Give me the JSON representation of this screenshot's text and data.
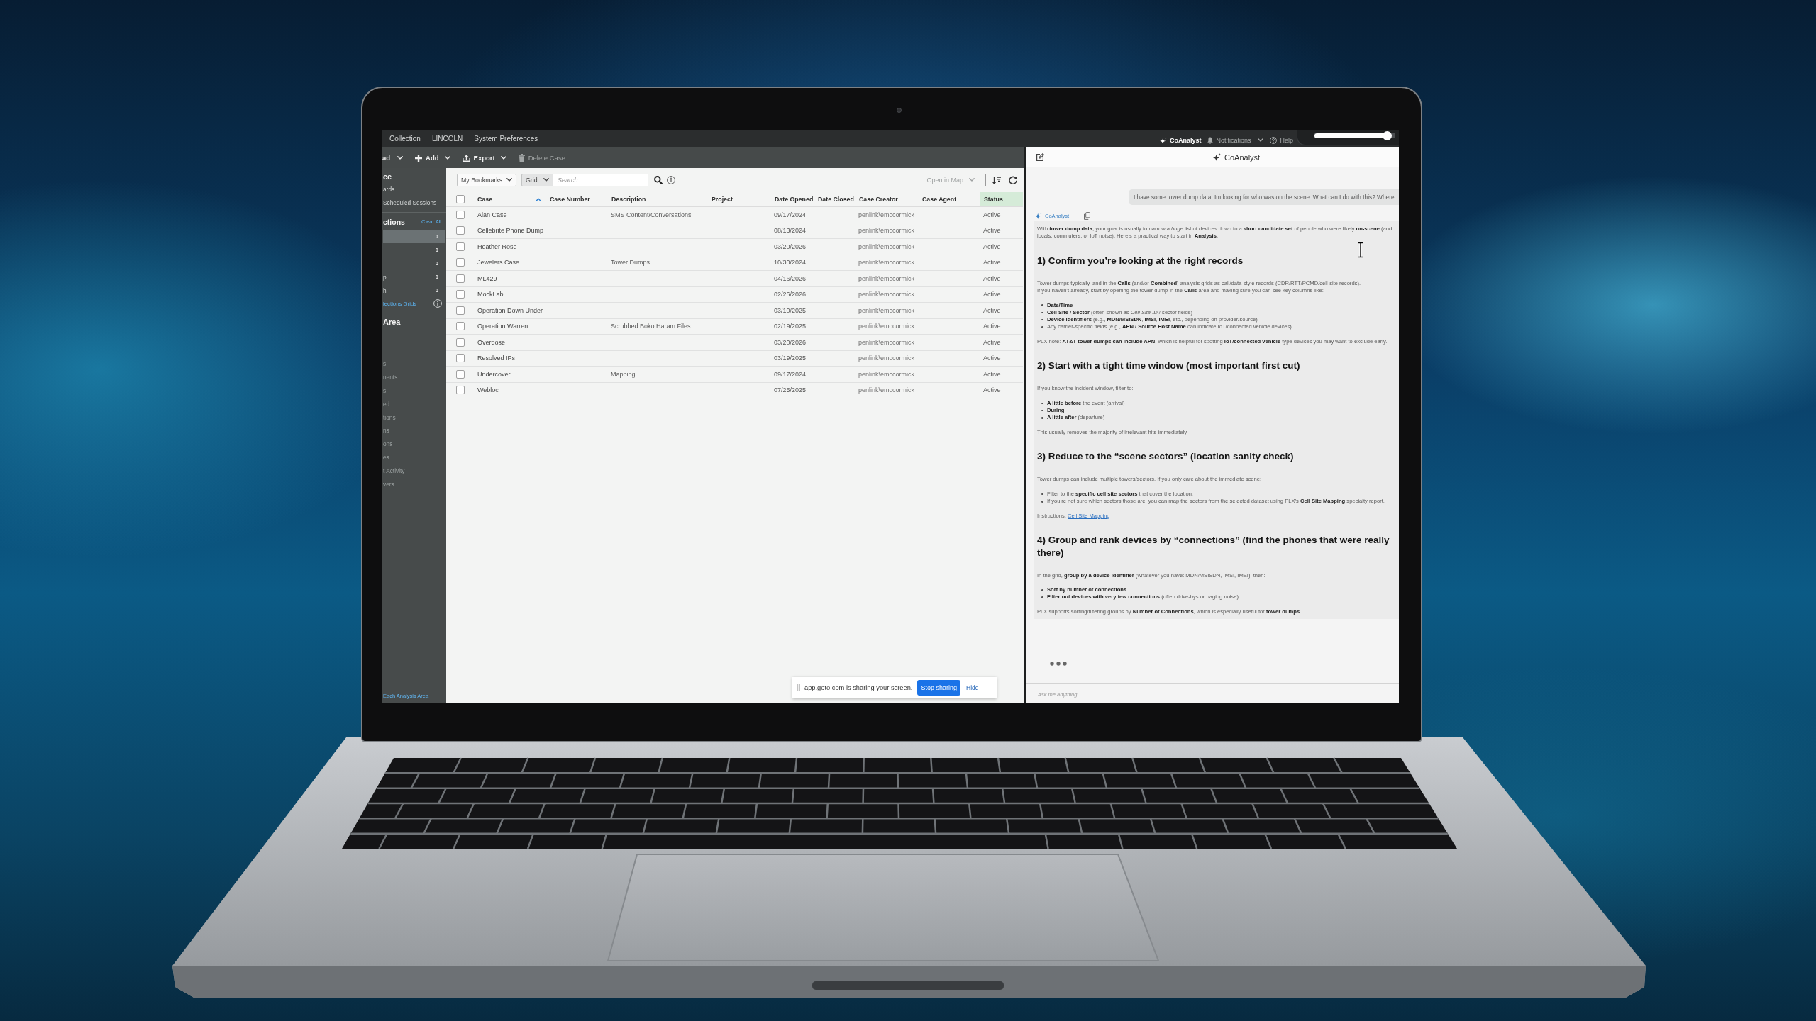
{
  "top_bar": {
    "tabs": [
      "Collection",
      "LINCOLN",
      "System Preferences"
    ],
    "actions": [
      {
        "kind": "assistant",
        "label": "CoAnalyst",
        "selected": true,
        "dropdown": false
      },
      {
        "kind": "notifications",
        "label": "Notifications",
        "selected": false,
        "dropdown": true
      },
      {
        "kind": "help",
        "label": "Help",
        "selected": false,
        "dropdown": false
      }
    ]
  },
  "overlay_slider": {
    "level": 0.95
  },
  "toolbar": {
    "items": [
      {
        "kind": "dropdown",
        "label": "ad",
        "dropdown": true,
        "disabled": false
      },
      {
        "kind": "add",
        "label": "Add",
        "dropdown": true,
        "disabled": false
      },
      {
        "kind": "export",
        "label": "Export",
        "dropdown": true,
        "disabled": false
      },
      {
        "kind": "delete",
        "label": "Delete Case",
        "dropdown": false,
        "disabled": true
      }
    ]
  },
  "sidebar": {
    "title": "ce",
    "links": [
      "ards",
      "Scheduled Sessions"
    ],
    "selections": {
      "title": "ctions",
      "clear_link": "Clear All",
      "items": [
        {
          "count": "0",
          "selected": true
        },
        {
          "count": "0",
          "selected": false
        },
        {
          "count": "0",
          "selected": false
        },
        {
          "label": "p",
          "count": "0",
          "selected": false
        },
        {
          "label": "h",
          "count": "0",
          "selected": false
        }
      ],
      "grids_link": "lections Grids"
    },
    "area": {
      "title": "Area",
      "items": [
        {
          "label": "s",
          "disabled": true
        },
        {
          "label": "nents",
          "disabled": true
        },
        {
          "label": "s",
          "disabled": true
        },
        {
          "label": "ed",
          "disabled": true
        },
        {
          "label": "tions",
          "disabled": true
        },
        {
          "label": "ns",
          "disabled": true
        },
        {
          "label": "ons",
          "disabled": true
        },
        {
          "label": "es",
          "disabled": true
        },
        {
          "label": "t Activity",
          "disabled": true
        },
        {
          "label": "vers",
          "disabled": true
        }
      ]
    },
    "footer_link": "Each Analysis Area"
  },
  "grid": {
    "controls": {
      "bookmarks": "My Bookmarks",
      "view": "Grid",
      "search_placeholder": "Search...",
      "open_in_map": {
        "label": "Open in Map",
        "disabled": true
      }
    },
    "header_checked": false,
    "columns": [
      {
        "label": "Case",
        "sorted": true,
        "highlighted": false
      },
      {
        "label": "Case Number",
        "sorted": false,
        "highlighted": false
      },
      {
        "label": "Description",
        "sorted": false,
        "highlighted": false
      },
      {
        "label": "Project",
        "sorted": false,
        "highlighted": false
      },
      {
        "label": "Date Opened",
        "sorted": false,
        "highlighted": false
      },
      {
        "label": "Date Closed",
        "sorted": false,
        "highlighted": false
      },
      {
        "label": "Case Creator",
        "sorted": false,
        "highlighted": false
      },
      {
        "label": "Case Agent",
        "sorted": false,
        "highlighted": false
      },
      {
        "label": "Status",
        "sorted": false,
        "highlighted": true
      }
    ],
    "rows": [
      {
        "checked": false,
        "case": "Alan Case",
        "description": "SMS Content/Conversations",
        "date_opened": "09/17/2024",
        "case_creator": "penlink\\emccormick",
        "status": "Active"
      },
      {
        "checked": false,
        "case": "Cellebrite Phone Dump",
        "date_opened": "08/13/2024",
        "case_creator": "penlink\\emccormick",
        "status": "Active"
      },
      {
        "checked": false,
        "case": "Heather Rose",
        "date_opened": "03/20/2026",
        "case_creator": "penlink\\emccormick",
        "status": "Active"
      },
      {
        "checked": false,
        "case": "Jewelers Case",
        "description": "Tower Dumps",
        "date_opened": "10/30/2024",
        "case_creator": "penlink\\emccormick",
        "status": "Active"
      },
      {
        "checked": false,
        "case": "ML429",
        "date_opened": "04/16/2026",
        "case_creator": "penlink\\emccormick",
        "status": "Active"
      },
      {
        "checked": false,
        "case": "MockLab",
        "date_opened": "02/26/2026",
        "case_creator": "penlink\\emccormick",
        "status": "Active"
      },
      {
        "checked": false,
        "case": "Operation Down Under",
        "date_opened": "03/10/2025",
        "case_creator": "penlink\\emccormick",
        "status": "Active"
      },
      {
        "checked": false,
        "case": "Operation Warren",
        "description": "Scrubbed Boko Haram Files",
        "date_opened": "02/19/2025",
        "case_creator": "penlink\\emccormick",
        "status": "Active"
      },
      {
        "checked": false,
        "case": "Overdose",
        "date_opened": "03/20/2026",
        "case_creator": "penlink\\emccormick",
        "status": "Active"
      },
      {
        "checked": false,
        "case": "Resolved IPs",
        "date_opened": "03/19/2025",
        "case_creator": "penlink\\emccormick",
        "status": "Active"
      },
      {
        "checked": false,
        "case": "Undercover",
        "description": "Mapping",
        "date_opened": "09/17/2024",
        "case_creator": "penlink\\emccormick",
        "status": "Active"
      },
      {
        "checked": false,
        "case": "Webloc",
        "date_opened": "07/25/2025",
        "case_creator": "penlink\\emccormick",
        "status": "Active"
      }
    ]
  },
  "share_banner": {
    "message": "app.goto.com is sharing your screen.",
    "stop_button": "Stop sharing",
    "hide_link": "Hide"
  },
  "coanalyst": {
    "title": "CoAnalyst",
    "user_message": "I have some tower dump data. Im looking for who was on the scene. What can I do with this? Where",
    "assistant_label": "CoAnalyst",
    "response": [
      {
        "kind": "paragraph",
        "lines": [
          "With **tower dump data**, your goal is usually to narrow a *huge* list of devices down to a **short candidate set** of people who were likely **on-scene** (and",
          "locals, commuters, or IoT noise). Here’s a practical way to start in **Analysis**."
        ]
      },
      {
        "kind": "heading",
        "text": "1) Confirm you’re looking at the right records"
      },
      {
        "kind": "paragraph",
        "lines": [
          "Tower dumps typically land in the **Calls** (and/or **Combined**) analysis grids as call/data-style records (CDR/RTT/PCMD/cell-site records).",
          "If you haven’t already, start by opening the tower dump in the **Calls** area and making sure you can see key columns like:"
        ]
      },
      {
        "kind": "list",
        "items": [
          "**Date/Time**",
          "**Cell Site / Sector** (often shown as *Cell Site ID* / sector fields)",
          "**Device identifiers** (e.g., **MDN/MSISDN**, **IMSI**, **IMEI**, etc., depending on provider/source)",
          "Any carrier-specific fields (e.g., **APN / Source Host Name** can indicate IoT/connected vehicle devices)"
        ]
      },
      {
        "kind": "paragraph",
        "lines": [
          "PLX note: **AT&T tower dumps can include APN**, which is helpful for spotting **IoT/connected vehicle** type devices you may want to exclude early."
        ]
      },
      {
        "kind": "heading",
        "text": "2) Start with a tight time window (most important first cut)"
      },
      {
        "kind": "paragraph",
        "lines": [
          "If you know the incident window, filter to:"
        ]
      },
      {
        "kind": "list",
        "items": [
          "**A little before** the event (arrival)",
          "**During**",
          "**A little after** (departure)"
        ]
      },
      {
        "kind": "paragraph",
        "lines": [
          "This usually removes the majority of irrelevant hits immediately."
        ]
      },
      {
        "kind": "heading",
        "text": "3) Reduce to the “scene sectors” (location sanity check)"
      },
      {
        "kind": "paragraph",
        "lines": [
          "Tower dumps can include multiple towers/sectors. If you only care about the immediate scene:"
        ]
      },
      {
        "kind": "list",
        "items": [
          "Filter to the **specific cell site sectors** that cover the location.",
          "If you’re not sure which sectors those are, you can map the sectors from the selected dataset using PLX’s **Cell Site Mapping** specialty report."
        ]
      },
      {
        "kind": "link_line",
        "text": "Instructions:",
        "link": "Cell Site Mapping"
      },
      {
        "kind": "heading",
        "text": "4) Group and rank devices by “connections” (find the phones that were really there)"
      },
      {
        "kind": "paragraph",
        "lines": [
          "In the grid, **group by a device identifier** (whatever you have: MDN/MSISDN, IMSI, IMEI), then:"
        ]
      },
      {
        "kind": "list",
        "items": [
          "**Sort by number of connections**",
          "**Filter out devices with very few connections** (often drive-bys or paging noise)"
        ]
      },
      {
        "kind": "paragraph",
        "lines": [
          "PLX supports sorting/filtering groups by **Number of Connections**, which is especially useful for **tower dumps**"
        ]
      }
    ],
    "typing": true,
    "input_placeholder": "Ask me anything..."
  }
}
